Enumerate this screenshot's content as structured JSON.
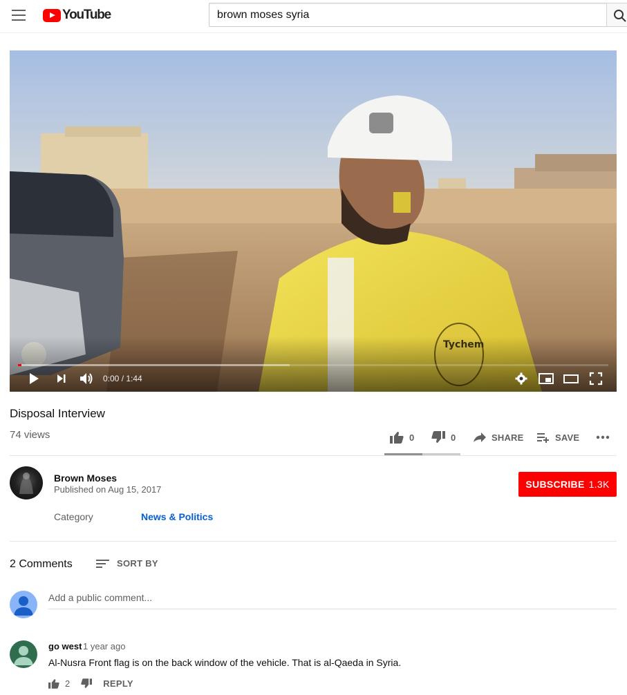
{
  "header": {
    "logo_text": "YouTube",
    "search_query": "brown moses syria"
  },
  "player": {
    "time_display": "0:00 / 1:44",
    "played_fraction": 0.006,
    "buffered_fraction": 0.46
  },
  "video": {
    "title": "Disposal Interview",
    "views": "74 views",
    "likes": "0",
    "dislikes": "0",
    "share_label": "SHARE",
    "save_label": "SAVE"
  },
  "owner": {
    "channel_name": "Brown Moses",
    "published": "Published on Aug 15, 2017",
    "subscribe_label": "SUBSCRIBE",
    "subscriber_count": "1.3K",
    "category_label": "Category",
    "category_value": "News & Politics"
  },
  "comments": {
    "count_label": "2 Comments",
    "sort_label": "SORT BY",
    "placeholder": "Add a public comment...",
    "items": [
      {
        "author": "go west",
        "time": "1 year ago",
        "text": "Al-Nusra Front flag is on the back window of the vehicle. That is al-Qaeda in Syria.",
        "likes": "2",
        "reply_label": "REPLY"
      }
    ]
  },
  "colors": {
    "brand_red": "#ff0000",
    "link_blue": "#065fd4",
    "secondary_text": "#606060"
  }
}
